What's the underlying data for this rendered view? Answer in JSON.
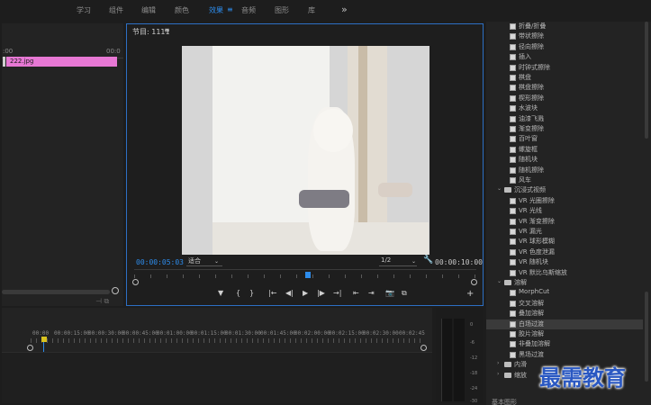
{
  "workspace_tabs": [
    "学习",
    "组件",
    "编辑",
    "颜色",
    "效果",
    "音频",
    "图形",
    "库"
  ],
  "active_tab": "效果",
  "tab_menu_icon": "≡",
  "more_tabs_icon": "»",
  "left_panel": {
    "ruler_left": ":00",
    "ruler_right": "00:0",
    "clip_name": "222.jpg",
    "clip_color": "#e778d4"
  },
  "program_monitor": {
    "title": "节目: 1111",
    "menu_icon": "≡",
    "timecode_current": "00:00:05:03",
    "fit_label": "适合",
    "resolution": "1/2",
    "timecode_duration": "00:00:10:00",
    "transport": [
      "▼",
      "{",
      "}",
      "|←",
      "◀|",
      "▶",
      "|▶",
      "→|",
      "⇤",
      "⇥",
      "📷",
      "⧉",
      "+"
    ]
  },
  "timeline": {
    "times": [
      "00:00",
      "00:00:15:00",
      "00:00:30:00",
      "00:00:45:00",
      "00:01:00:00",
      "00:01:15:00",
      "00:01:30:00",
      "00:01:45:00",
      "00:02:00:00",
      "00:02:15:00",
      "00:02:30:00",
      "00:02:45"
    ]
  },
  "meter_labels": [
    "0",
    "-6",
    "-12",
    "-18",
    "-24",
    "-30"
  ],
  "effects_panel": {
    "rows": [
      {
        "kind": "item",
        "label": "折叠/折叠",
        "indent": 2
      },
      {
        "kind": "item",
        "label": "带状擦除",
        "indent": 2
      },
      {
        "kind": "item",
        "label": "径向擦除",
        "indent": 2
      },
      {
        "kind": "item",
        "label": "插入",
        "indent": 2
      },
      {
        "kind": "item",
        "label": "时钟式擦除",
        "indent": 2
      },
      {
        "kind": "item",
        "label": "棋盘",
        "indent": 2
      },
      {
        "kind": "item",
        "label": "棋盘擦除",
        "indent": 2
      },
      {
        "kind": "item",
        "label": "楔形擦除",
        "indent": 2
      },
      {
        "kind": "item",
        "label": "水波块",
        "indent": 2
      },
      {
        "kind": "item",
        "label": "油漆飞溅",
        "indent": 2
      },
      {
        "kind": "item",
        "label": "渐变擦除",
        "indent": 2
      },
      {
        "kind": "item",
        "label": "百叶窗",
        "indent": 2
      },
      {
        "kind": "item",
        "label": "螺旋框",
        "indent": 2
      },
      {
        "kind": "item",
        "label": "随机块",
        "indent": 2
      },
      {
        "kind": "item",
        "label": "随机擦除",
        "indent": 2
      },
      {
        "kind": "item",
        "label": "风车",
        "indent": 2
      },
      {
        "kind": "folder",
        "label": "沉浸式视频",
        "expanded": true,
        "indent": 1
      },
      {
        "kind": "item",
        "label": "VR 光圈擦除",
        "indent": 2
      },
      {
        "kind": "item",
        "label": "VR 光线",
        "indent": 2
      },
      {
        "kind": "item",
        "label": "VR 渐变擦除",
        "indent": 2
      },
      {
        "kind": "item",
        "label": "VR 漏光",
        "indent": 2
      },
      {
        "kind": "item",
        "label": "VR 球形模糊",
        "indent": 2
      },
      {
        "kind": "item",
        "label": "VR 色度泄漏",
        "indent": 2
      },
      {
        "kind": "item",
        "label": "VR 随机块",
        "indent": 2
      },
      {
        "kind": "item",
        "label": "VR 默比乌斯缩放",
        "indent": 2
      },
      {
        "kind": "folder",
        "label": "溶解",
        "expanded": true,
        "indent": 1
      },
      {
        "kind": "item",
        "label": "MorphCut",
        "indent": 2
      },
      {
        "kind": "item",
        "label": "交叉溶解",
        "indent": 2
      },
      {
        "kind": "item",
        "label": "叠加溶解",
        "indent": 2
      },
      {
        "kind": "item",
        "label": "白场过渡",
        "indent": 2,
        "selected": true
      },
      {
        "kind": "item",
        "label": "胶片溶解",
        "indent": 2
      },
      {
        "kind": "item",
        "label": "非叠加溶解",
        "indent": 2
      },
      {
        "kind": "item",
        "label": "黑场过渡",
        "indent": 2
      },
      {
        "kind": "folder",
        "label": "内滑",
        "expanded": false,
        "indent": 1
      },
      {
        "kind": "folder",
        "label": "缩放",
        "expanded": false,
        "indent": 1
      }
    ],
    "footer": "基本图形"
  },
  "watermark": "最需教育"
}
